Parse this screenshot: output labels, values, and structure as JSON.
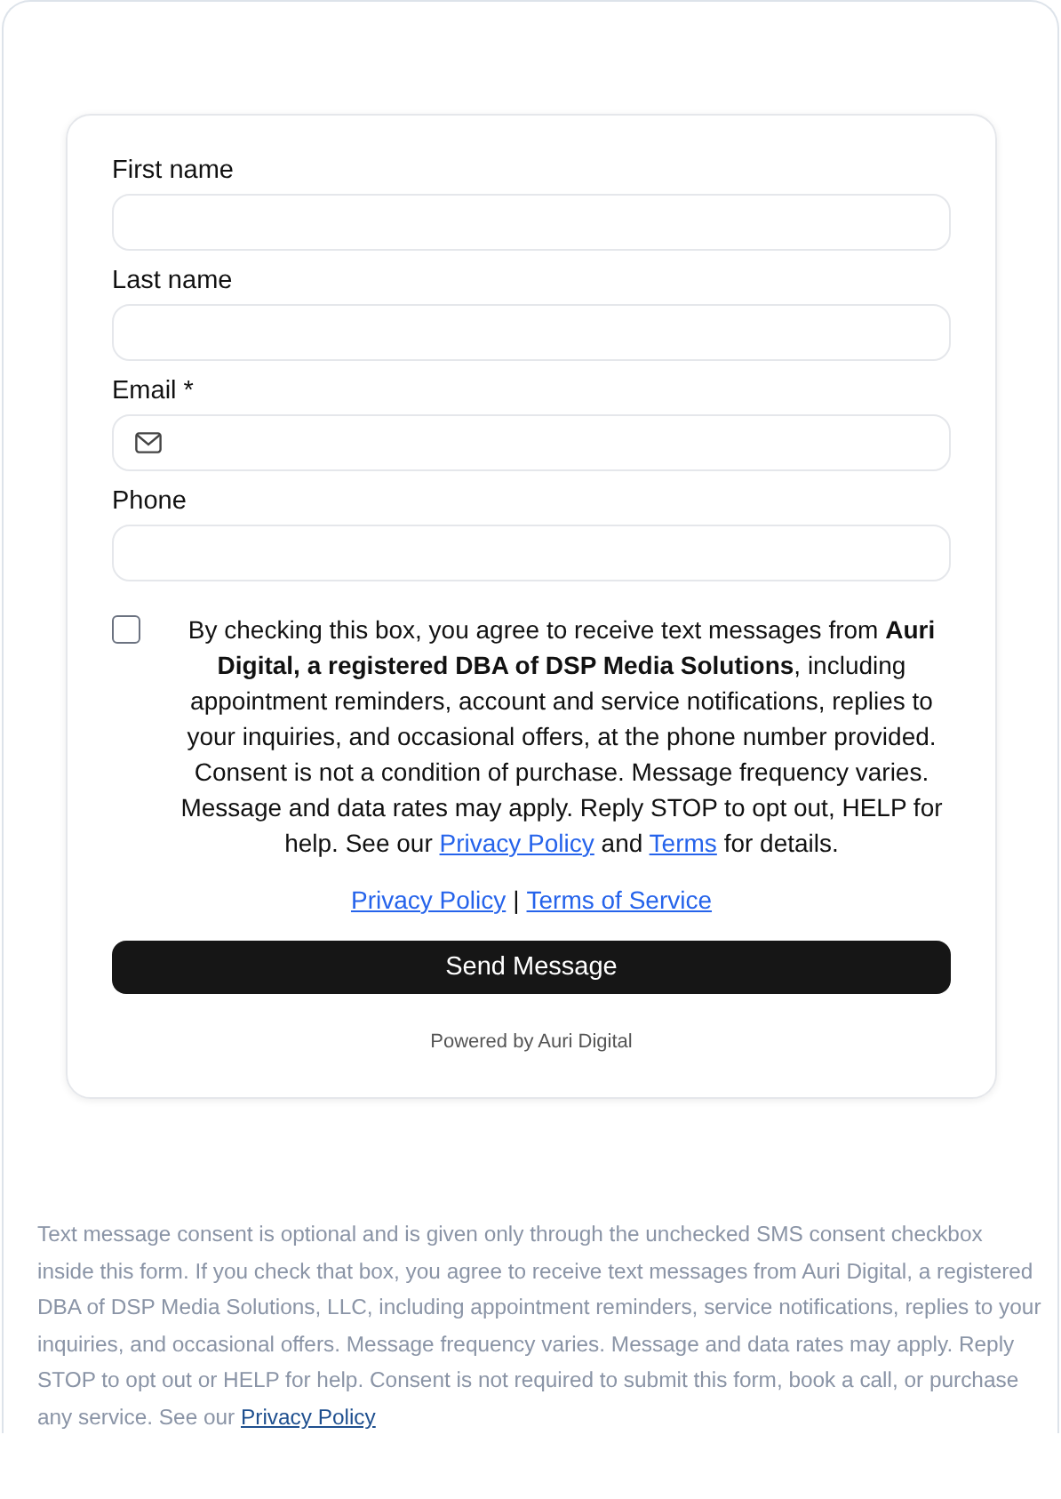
{
  "form": {
    "fields": [
      {
        "label": "First name",
        "kind": "text"
      },
      {
        "label": "Last name",
        "kind": "text"
      },
      {
        "label": "Email *",
        "kind": "email"
      },
      {
        "label": "Phone",
        "kind": "text"
      }
    ],
    "consent": {
      "checked": false,
      "text": "By checking this box, you agree to receive text messages from **Auri Digital, a registered DBA of DSP Media Solutions**, including appointment reminders, account and service notifications, replies to your inquiries, and occasional offers, at the phone number provided. Consent is not a condition of purchase. Message frequency varies. Message and data rates may apply. Reply STOP to opt out, HELP for help. See our",
      "privacy_link": "Privacy Policy",
      "middle": "and",
      "terms_link": "Terms",
      "end": "for details."
    },
    "links": [
      {
        "label": "Privacy Policy"
      },
      {
        "label": "Terms of Service"
      }
    ],
    "link_separator": "|",
    "submit": "Send Message",
    "powered_by": "Powered by Auri Digital"
  },
  "disclaimer": {
    "text": "Text message consent is optional and is given only through the unchecked SMS consent checkbox inside this form. If you check that box, you agree to receive text messages from Auri Digital, a registered DBA of DSP Media Solutions, LLC, including appointment reminders, service notifications, replies to your inquiries, and occasional offers. Message frequency varies. Message and data rates may apply. Reply STOP to opt out or HELP for help. Consent is not required to submit this form, book a call, or purchase any service. See our",
    "link": "Privacy Policy"
  }
}
